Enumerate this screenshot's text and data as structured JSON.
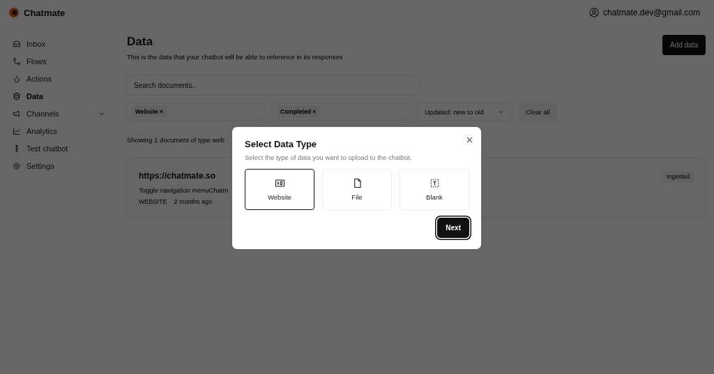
{
  "header": {
    "brand": "Chatmate",
    "account": "chatmate.dev@gmail.com"
  },
  "sidebar": {
    "items": [
      {
        "kind": "inbox",
        "label": "Inbox",
        "selected": false
      },
      {
        "kind": "flows",
        "label": "Flows",
        "selected": false
      },
      {
        "kind": "actions",
        "label": "Actions",
        "selected": false
      },
      {
        "kind": "data",
        "label": "Data",
        "selected": true
      },
      {
        "kind": "channels",
        "label": "Channels",
        "selected": false,
        "expandable": true
      },
      {
        "kind": "analytics",
        "label": "Analytics",
        "selected": false
      },
      {
        "kind": "test",
        "label": "Test chatbot",
        "selected": false
      },
      {
        "kind": "settings",
        "label": "Settings",
        "selected": false
      }
    ]
  },
  "page": {
    "title": "Data",
    "subtitle": "This is the data that your chatbot will be able to reference in its responses",
    "add_button": "Add data",
    "search": {
      "placeholder": "Search documents.."
    },
    "filters": [
      {
        "label": "Website",
        "remove": "×"
      },
      {
        "label": "Completed",
        "remove": "×"
      }
    ],
    "sort": {
      "value": "Updated: new to old"
    },
    "clear_button": "Clear all",
    "summary": "Showing 1 document of type web",
    "documents": [
      {
        "title": "https://chatmate.so",
        "excerpt": "Toggle navigation menuChatm",
        "type": "WEBSITE",
        "time": "2 months ago",
        "status": "Ingested"
      }
    ]
  },
  "dialog": {
    "title": "Select Data Type",
    "subtitle": "Select the type of data you want to upload to the chatbot.",
    "options": [
      {
        "kind": "website",
        "label": "Website",
        "selected": true
      },
      {
        "kind": "file",
        "label": "File",
        "selected": false
      },
      {
        "kind": "blank",
        "label": "Blank",
        "selected": false
      }
    ],
    "next_button": "Next"
  }
}
